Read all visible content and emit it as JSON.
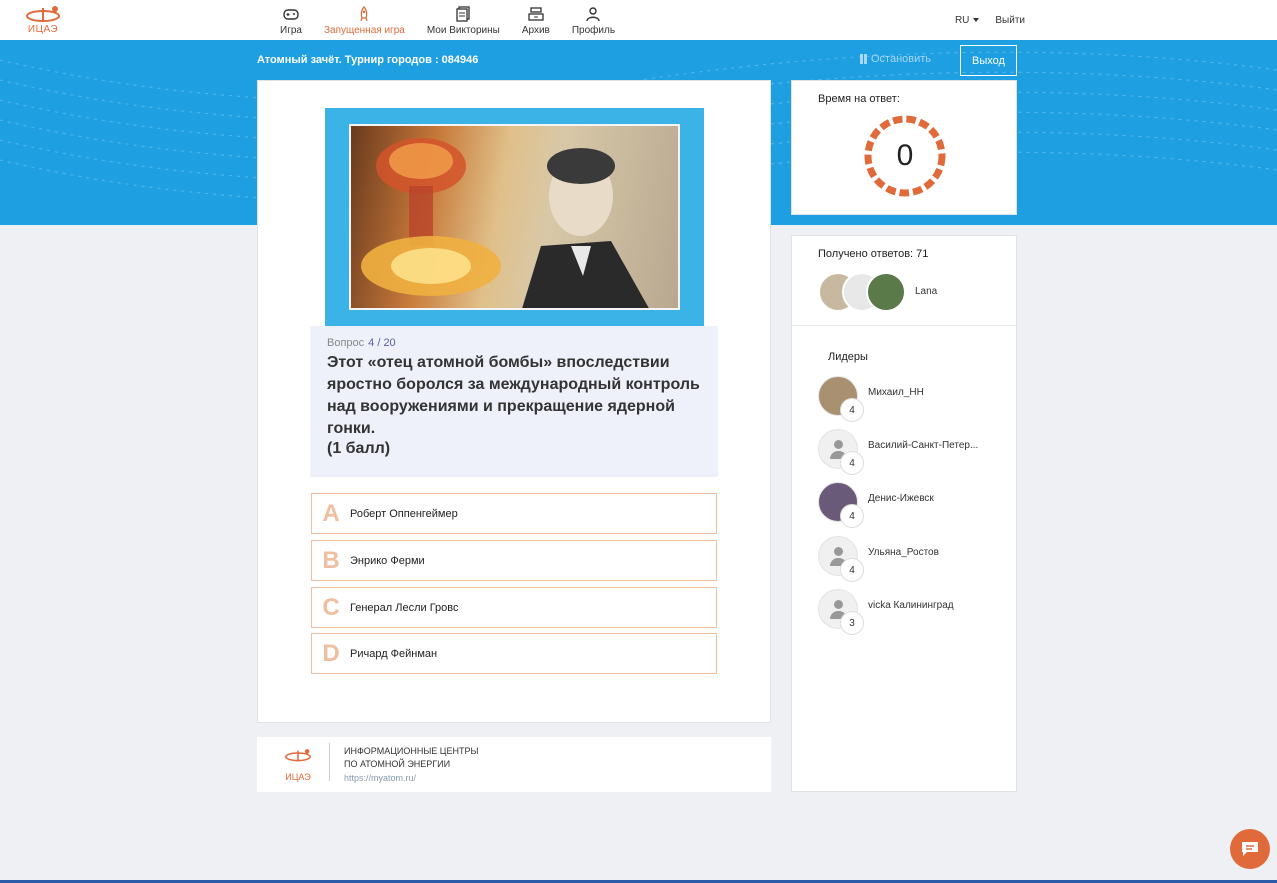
{
  "brand": {
    "logo_text": "ИЦАЭ",
    "accent": "#e06a3a",
    "blue": "#1e9fe2"
  },
  "nav": {
    "items": [
      {
        "label": "Игра",
        "icon": "gamepad-icon",
        "active": false
      },
      {
        "label": "Запущенная игра",
        "icon": "rocket-icon",
        "active": true
      },
      {
        "label": "Мои Викторины",
        "icon": "documents-icon",
        "active": false
      },
      {
        "label": "Архив",
        "icon": "archive-icon",
        "active": false
      },
      {
        "label": "Профиль",
        "icon": "user-icon",
        "active": false
      }
    ],
    "lang": "RU",
    "logout": "Выйти"
  },
  "game": {
    "title": "Атомный зачёт. Турнир городов : 084946",
    "stop_label": "Остановить",
    "exit_label": "Выход"
  },
  "question": {
    "label": "Вопрос",
    "number": "4 / 20",
    "text": "Этот «отец атомной бомбы» впоследствии яростно боролся за международный контроль над вооружениями и прекращение ядерной гонки.",
    "points": "(1 балл)"
  },
  "answers": [
    {
      "letter": "A",
      "text": "Роберт Оппенгеймер"
    },
    {
      "letter": "B",
      "text": "Энрико Ферми"
    },
    {
      "letter": "C",
      "text": "Генерал Лесли Гровс"
    },
    {
      "letter": "D",
      "text": "Ричард Фейнман"
    }
  ],
  "footer": {
    "logo_text": "ИЦАЭ",
    "line1": "ИНФОРМАЦИОННЫЕ ЦЕНТРЫ",
    "line2": "ПО АТОМНОЙ ЭНЕРГИИ",
    "link": "https://myatom.ru/"
  },
  "timer": {
    "label": "Время на ответ:",
    "value": "0"
  },
  "responses": {
    "label": "Получено ответов: 71",
    "last_name": "Lana"
  },
  "leaders": {
    "title": "Лидеры",
    "items": [
      {
        "name": "Михаил_НН",
        "score": "4",
        "avatar": "photo"
      },
      {
        "name": "Василий-Санкт-Петер...",
        "score": "4",
        "avatar": "generic"
      },
      {
        "name": "Денис-Ижевск",
        "score": "4",
        "avatar": "photo"
      },
      {
        "name": "Ульяна_Ростов",
        "score": "4",
        "avatar": "generic"
      },
      {
        "name": "vicka Калининград",
        "score": "3",
        "avatar": "generic"
      }
    ]
  },
  "chat": {
    "icon": "chat-icon"
  }
}
